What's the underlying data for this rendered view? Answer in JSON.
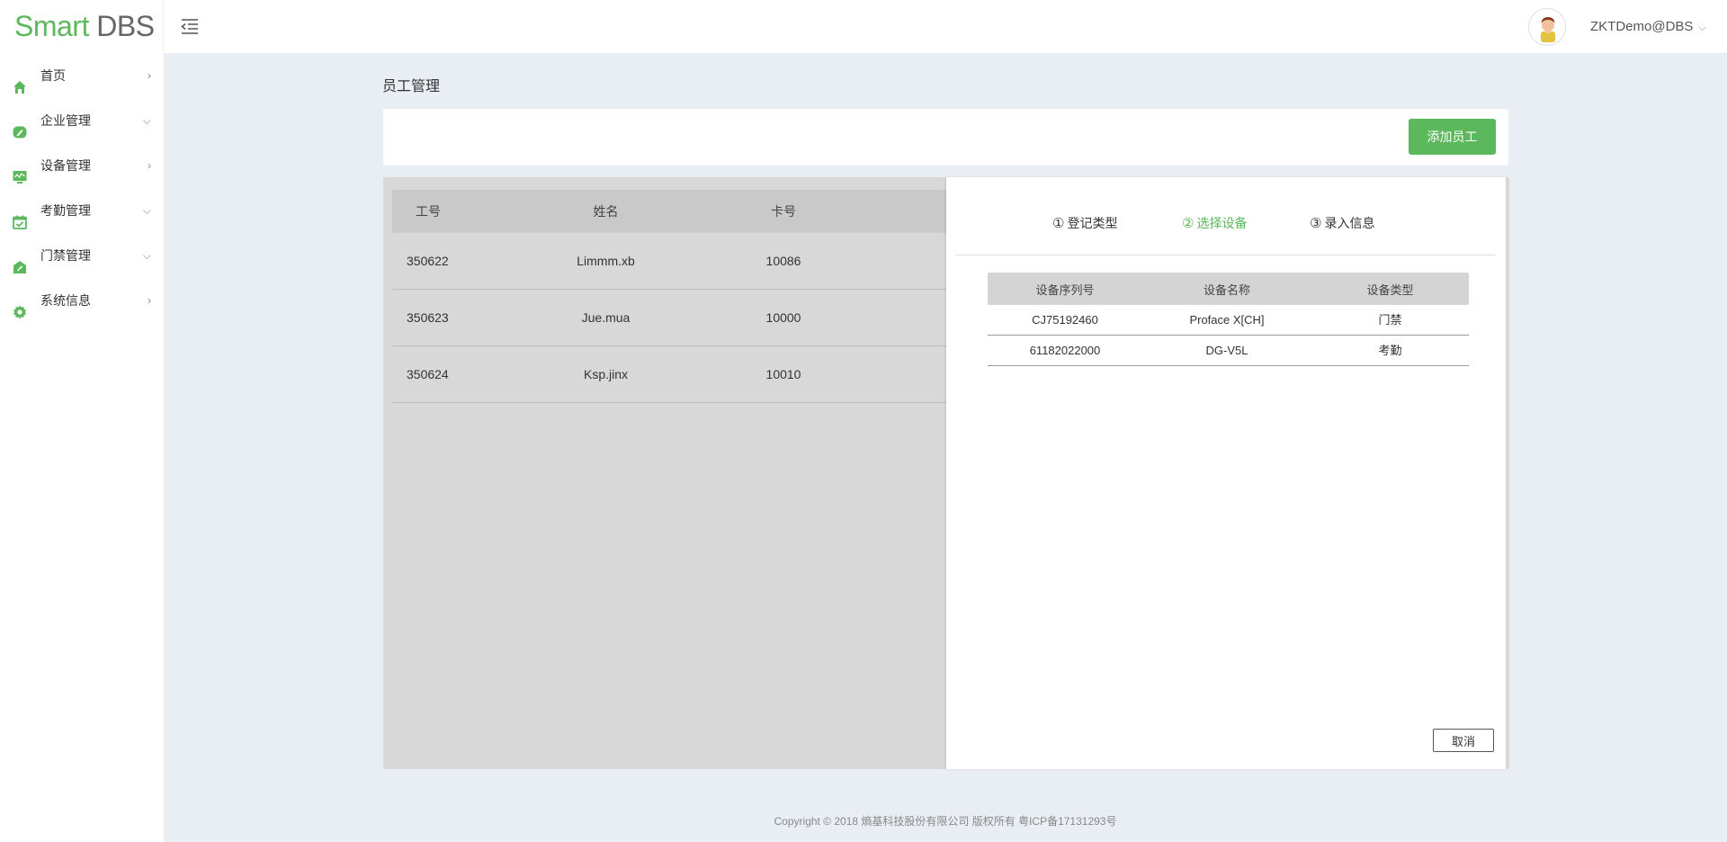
{
  "brand": {
    "part1": "Smart",
    "part2": "DBS"
  },
  "header": {
    "user": "ZKTDemo@DBS",
    "caret": "⌵"
  },
  "sidebar": {
    "items": [
      {
        "label": "首页",
        "arrow": "›",
        "icon": "home-icon"
      },
      {
        "label": "企业管理",
        "arrow": "⌵",
        "icon": "edit-icon"
      },
      {
        "label": "设备管理",
        "arrow": "›",
        "icon": "monitor-icon"
      },
      {
        "label": "考勤管理",
        "arrow": "⌵",
        "icon": "calendar-icon"
      },
      {
        "label": "门禁管理",
        "arrow": "⌵",
        "icon": "door-icon"
      },
      {
        "label": "系统信息",
        "arrow": "›",
        "icon": "gear-icon"
      }
    ]
  },
  "page": {
    "title": "员工管理",
    "add_button": "添加员工"
  },
  "employees": {
    "headers": [
      "工号",
      "姓名",
      "卡号"
    ],
    "rows": [
      [
        "350622",
        "Limmm.xb",
        "10086"
      ],
      [
        "350623",
        "Jue.mua",
        "10000"
      ],
      [
        "350624",
        "Ksp.jinx",
        "10010"
      ]
    ]
  },
  "wizard": {
    "steps": [
      {
        "num": "①",
        "label": "登记类型",
        "active": false
      },
      {
        "num": "②",
        "label": "选择设备",
        "active": true
      },
      {
        "num": "③",
        "label": "录入信息",
        "active": false
      }
    ],
    "device_headers": [
      "设备序列号",
      "设备名称",
      "设备类型"
    ],
    "devices": [
      [
        "CJ75192460",
        "Proface X[CH]",
        "门禁"
      ],
      [
        "61182022000",
        "DG-V5L",
        "考勤"
      ]
    ],
    "cancel": "取消"
  },
  "footer": "Copyright © 2018 熵基科技股份有限公司 版权所有 粤ICP备17131293号",
  "colors": {
    "accent": "#5cb85c",
    "bg": "#e9edf4"
  }
}
